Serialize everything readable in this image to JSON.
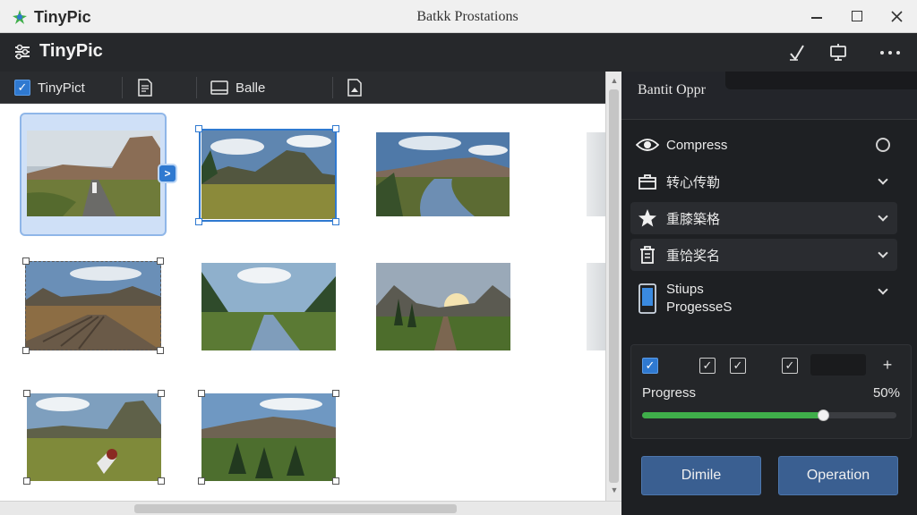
{
  "window": {
    "app_name": "TinyPic",
    "title": "Batkk Prostations",
    "minimize_icon": "minimize-icon",
    "maximize_icon": "maximize-icon",
    "close_icon": "close-icon"
  },
  "header": {
    "app_name": "TinyPic",
    "icons": [
      "wand-icon",
      "monitor-icon",
      "more-icon"
    ]
  },
  "toolbar": {
    "items": [
      {
        "label": "TinyPict",
        "icon": "checkbox-icon"
      },
      {
        "label": "",
        "icon": "document-icon"
      },
      {
        "label": "Balle",
        "icon": "window-icon"
      },
      {
        "label": "",
        "icon": "image-file-icon"
      }
    ]
  },
  "gallery": {
    "thumbnails": [
      {
        "scene": "road-mountain",
        "selected": true
      },
      {
        "scene": "meadow-rock",
        "selected": true
      },
      {
        "scene": "river-valley"
      },
      {
        "scene": "rail-plain",
        "selected": true
      },
      {
        "scene": "creek-forest"
      },
      {
        "scene": "sunset-path"
      },
      {
        "scene": "hill-rock",
        "selected": true
      },
      {
        "scene": "valley-forest",
        "selected": true
      }
    ]
  },
  "panel": {
    "title": "Bantit Oppr",
    "rows": [
      {
        "label": "Compress",
        "icon": "eye-icon",
        "control": "radio"
      },
      {
        "label": "转心传勒",
        "icon": "briefcase-icon",
        "control": "chevron"
      },
      {
        "label": "重膝築格",
        "icon": "star-icon",
        "control": "chevron"
      },
      {
        "label": "重饸奖名",
        "icon": "trash-icon",
        "control": "chevron"
      },
      {
        "label_line1": "Stiups",
        "label_line2": "ProgesseS",
        "icon": "device-icon",
        "control": "chevron"
      }
    ],
    "progress": {
      "label": "Progress",
      "value_text": "50%",
      "fraction": 0.71
    },
    "buttons": {
      "left": "Dimile",
      "right": "Operation"
    },
    "colors": {
      "accent": "#2f79d0",
      "progress": "#3fae4a",
      "button": "#3a5f91"
    }
  }
}
